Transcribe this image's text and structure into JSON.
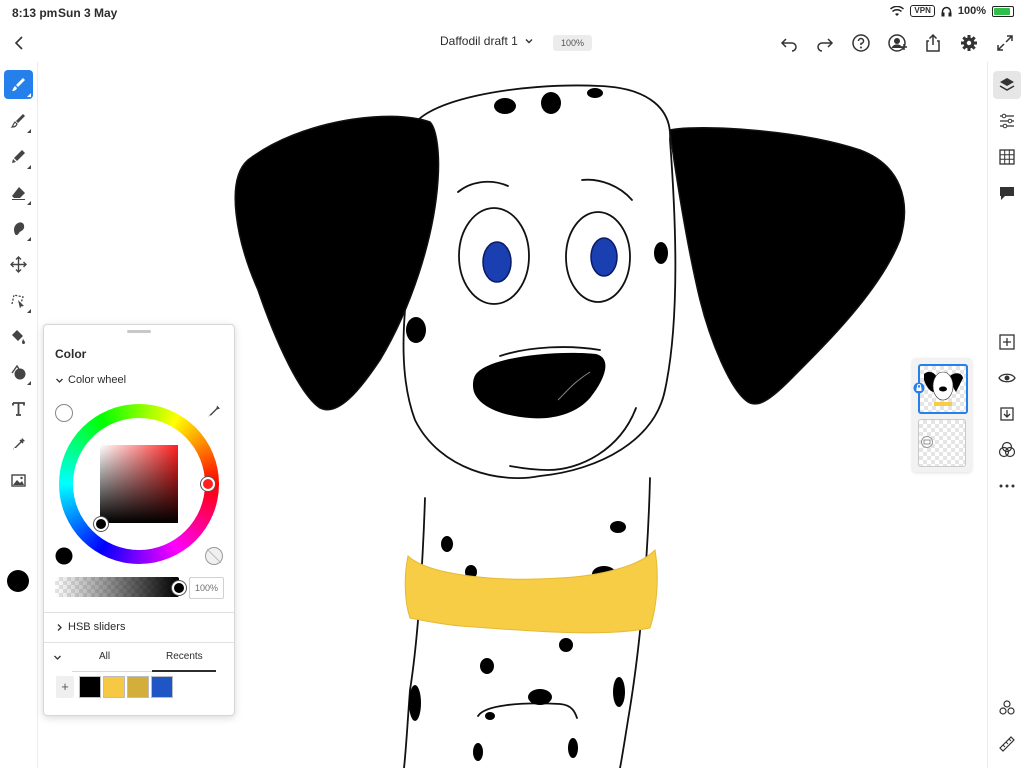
{
  "status_bar": {
    "time": "8:13 pm",
    "date": "Sun 3 May",
    "vpn": "VPN",
    "battery": "100%",
    "battery_level": 1.0
  },
  "document": {
    "title": "Daffodil draft 1",
    "zoom": "100%"
  },
  "top_icons": [
    "undo-icon",
    "redo-icon",
    "help-icon",
    "invite-icon",
    "share-icon",
    "settings-icon",
    "fullscreen-icon"
  ],
  "left_tools": [
    {
      "name": "pixel-brush",
      "active": true
    },
    {
      "name": "live-brush"
    },
    {
      "name": "vector-brush"
    },
    {
      "name": "eraser"
    },
    {
      "name": "smudge"
    },
    {
      "name": "move"
    },
    {
      "name": "selection"
    },
    {
      "name": "fill"
    },
    {
      "name": "shape"
    },
    {
      "name": "text"
    },
    {
      "name": "eyedropper"
    },
    {
      "name": "image"
    }
  ],
  "current_color": "#000000",
  "right_tools": [
    "layers-icon",
    "properties-icon",
    "grid-icon",
    "comments-icon",
    "add-layer-icon",
    "visibility-icon",
    "merge-icon",
    "blend-icon",
    "more-icon",
    "share-layers-icon",
    "ruler-icon"
  ],
  "color_panel": {
    "title": "Color",
    "color_wheel_label": "Color wheel",
    "opacity": "100%",
    "hsb_label": "HSB sliders",
    "tabs": [
      "All",
      "Recents"
    ],
    "active_tab": "Recents",
    "add_label": "+",
    "recent_swatches": [
      "#000000",
      "#f7c843",
      "#d3ae3b",
      "#1f55c4"
    ],
    "hue_color": "#ff2020",
    "fg_color": "#000000"
  }
}
